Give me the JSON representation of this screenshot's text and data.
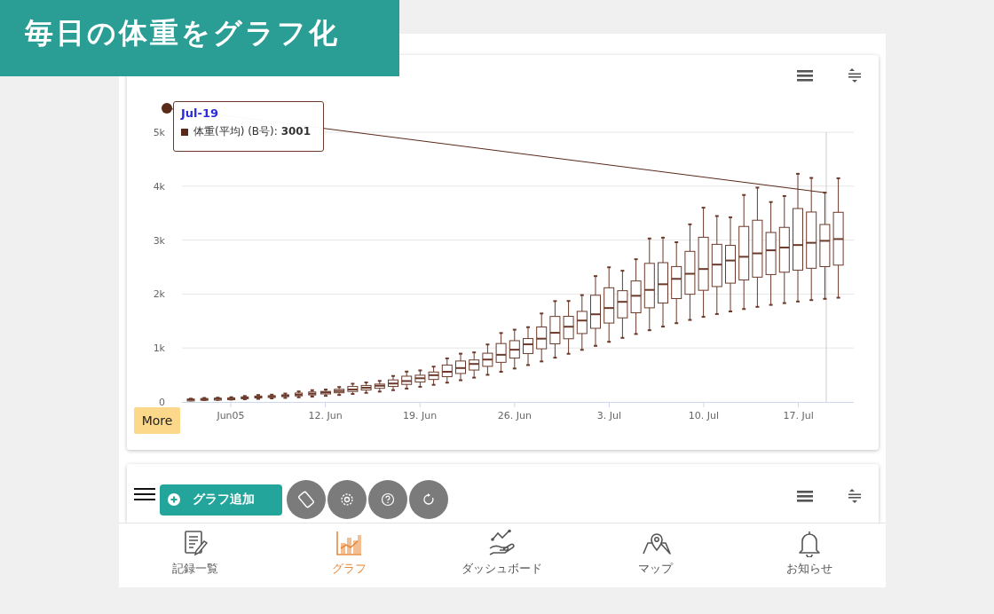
{
  "banner": {
    "title": "毎日の体重をグラフ化"
  },
  "chart": {
    "y_labels": [
      "5k",
      "4k",
      "3k",
      "2k",
      "1k",
      "0"
    ],
    "x_labels": [
      "Jun05",
      "12. Jun",
      "19. Jun",
      "26. Jun",
      "3. Jul",
      "10. Jul",
      "17. Jul"
    ],
    "tooltip": {
      "date": "Jul-19",
      "series": "体重(平均) (B号): **3001**"
    },
    "more_button": "More"
  },
  "fab": {
    "add_button": "グラフ追加"
  },
  "bottom_nav": [
    {
      "label": "記録一覧",
      "selected": false
    },
    {
      "label": "グラフ",
      "selected": true
    },
    {
      "label": "ダッシュボード",
      "selected": false
    },
    {
      "label": "マップ",
      "selected": false
    },
    {
      "label": "お知らせ",
      "selected": false
    }
  ]
}
